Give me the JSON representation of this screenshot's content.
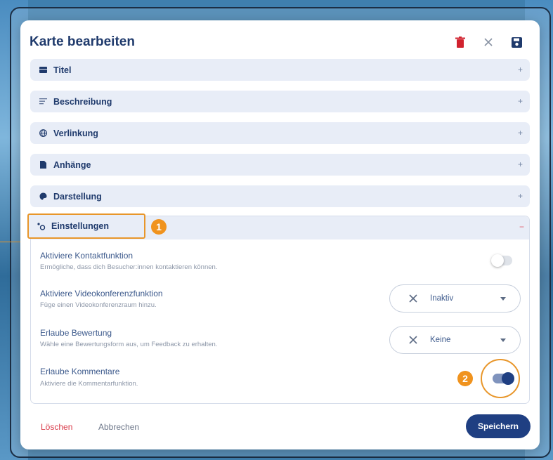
{
  "modal": {
    "title": "Karte bearbeiten",
    "actions": [
      {
        "icon": "trash-icon",
        "color": "#d1222e"
      },
      {
        "icon": "close-icon",
        "color": "#8892a3"
      },
      {
        "icon": "save-icon",
        "color": "#1f3a6c"
      }
    ]
  },
  "sections": [
    {
      "label": "Titel",
      "icon": "title-icon",
      "expand": "+"
    },
    {
      "label": "Beschreibung",
      "icon": "description-icon",
      "expand": "+"
    },
    {
      "label": "Verlinkung",
      "icon": "globe-icon",
      "expand": "+"
    },
    {
      "label": "Anhänge",
      "icon": "file-icon",
      "expand": "+"
    },
    {
      "label": "Darstellung",
      "icon": "palette-icon",
      "expand": "+"
    }
  ],
  "settings": {
    "label": "Einstellungen",
    "icon": "settings-icon",
    "collapse": "−",
    "badge": "1",
    "rows": [
      {
        "title": "Aktiviere Kontaktfunktion",
        "description": "Ermögliche, dass dich Besucher:innen kontaktieren können.",
        "control": "toggle",
        "state": "off"
      },
      {
        "title": "Aktiviere Videokonferenzfunktion",
        "description": "Füge einen Videokonferenzraum hinzu.",
        "control": "select",
        "value": "Inaktiv"
      },
      {
        "title": "Erlaube Bewertung",
        "description": "Wähle eine Bewertungsform aus, um Feedback zu erhalten.",
        "control": "select",
        "value": "Keine"
      },
      {
        "title": "Erlaube Kommentare",
        "description": "Aktiviere die Kommentarfunktion.",
        "control": "toggle",
        "state": "on",
        "badge": "2"
      }
    ]
  },
  "footer": {
    "delete_label": "Löschen",
    "cancel_label": "Abbrechen",
    "save_label": "Speichern"
  },
  "colors": {
    "accent": "#1f3f82",
    "highlight": "#e8962a",
    "danger": "#d93a49"
  }
}
